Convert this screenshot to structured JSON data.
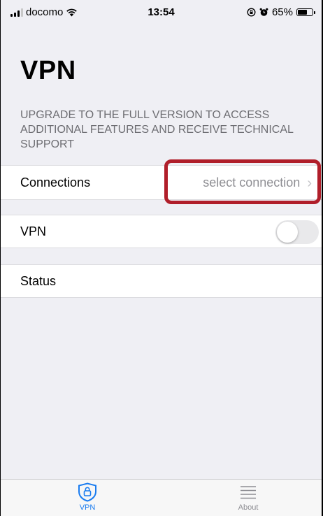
{
  "status_bar": {
    "carrier": "docomo",
    "time": "13:54",
    "battery": "65%",
    "battery_level": 0.65
  },
  "page": {
    "title": "VPN",
    "upgrade_note": "UPGRADE TO THE FULL VERSION TO ACCESS ADDITIONAL FEATURES AND RECEIVE TECHNICAL SUPPORT"
  },
  "rows": {
    "connections": {
      "label": "Connections",
      "value": "select connection"
    },
    "vpn": {
      "label": "VPN",
      "enabled": false
    },
    "status": {
      "label": "Status"
    }
  },
  "tab_bar": {
    "tabs": [
      {
        "label": "VPN",
        "icon": "shield-lock-icon",
        "selected": true
      },
      {
        "label": "About",
        "icon": "list-icon",
        "selected": false
      }
    ]
  },
  "colors": {
    "accent": "#1a7cf0",
    "highlight": "#b01e2a",
    "secondary_text": "#8e8e93",
    "background": "#efeff4"
  }
}
